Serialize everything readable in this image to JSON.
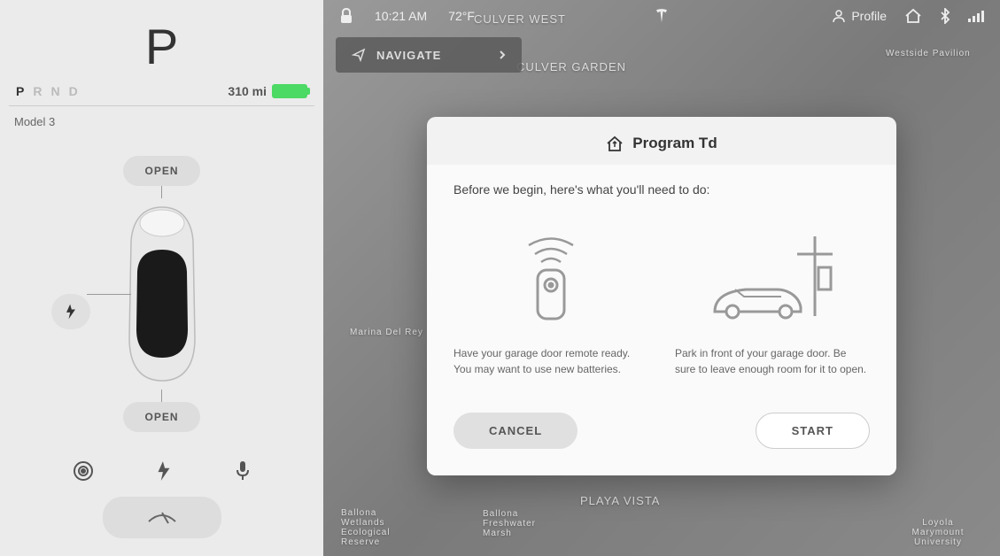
{
  "leftPanel": {
    "gear": "P",
    "gearLetters": [
      "P",
      "R",
      "N",
      "D"
    ],
    "activeGear": "P",
    "range": "310 mi",
    "modelName": "Model 3",
    "openFrunk": "OPEN",
    "openTrunk": "OPEN"
  },
  "statusBar": {
    "time": "10:21 AM",
    "temperature": "72°F",
    "profileLabel": "Profile"
  },
  "navigate": {
    "label": "NAVIGATE"
  },
  "modal": {
    "title": "Program Td",
    "intro": "Before we begin, here's what you'll need to do:",
    "step1": "Have your garage door remote ready. You may want to use new batteries.",
    "step2": "Park in front of your garage door. Be sure to leave enough room for it to open.",
    "cancel": "CANCEL",
    "start": "START"
  },
  "mapLabels": {
    "l1": "CULVER WEST",
    "l2": "CULVER GARDEN",
    "l3": "PLAYA VISTA",
    "l4": "Marina Del Rey",
    "l5": "Westside Pavilion",
    "l6": "Loyola Marymount University",
    "l7": "Ballona Freshwater Marsh",
    "l8": "Ballona Wetlands Ecological Reserve"
  }
}
